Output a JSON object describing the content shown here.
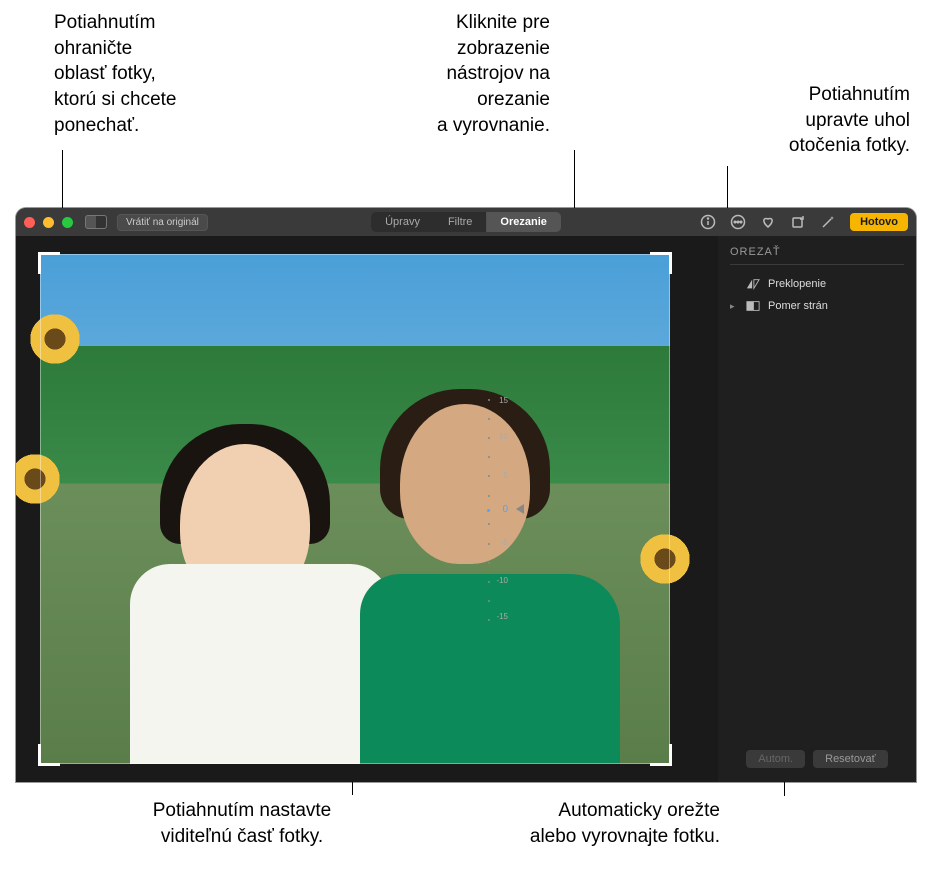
{
  "callouts": {
    "top_left": "Potiahnutím\nohraničte\noblasť fotky,\nktorú si chcete\nponechať.",
    "top_center": "Kliknite pre\nzobrazenie\nnástrojov na\norezanie\na vyrovnanie.",
    "top_right": "Potiahnutím\nupravte uhol\notočenia fotky.",
    "bottom_left": "Potiahnutím nastavte\nviditeľnú časť fotky.",
    "bottom_right": "Automaticky orežte\nalebo vyrovnajte fotku."
  },
  "toolbar": {
    "revert": "Vrátiť na originál",
    "tabs": {
      "adjust": "Úpravy",
      "filters": "Filtre",
      "crop": "Orezanie"
    },
    "done": "Hotovo"
  },
  "sidebar": {
    "title": "OREZAŤ",
    "flip": "Preklopenie",
    "aspect": "Pomer strán",
    "auto": "Autom.",
    "reset": "Resetovať"
  },
  "dial": {
    "ticks": [
      "15",
      "10",
      "5",
      "0",
      "-5",
      "-10",
      "-15"
    ],
    "value": 0
  }
}
